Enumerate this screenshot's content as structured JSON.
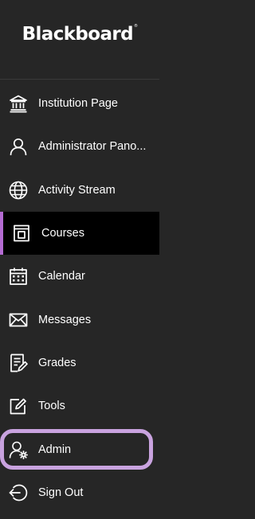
{
  "brand": {
    "logo_text": "Blackboard",
    "trademark": "®"
  },
  "colors": {
    "background": "#262626",
    "active_background": "#000000",
    "active_accent": "#b46bd2",
    "highlight_ring": "#c9a3df",
    "text": "#ffffff"
  },
  "nav": {
    "items": [
      {
        "label": "Institution Page",
        "icon": "institution-icon",
        "active": false,
        "highlighted": false
      },
      {
        "label": "Administrator Pano...",
        "icon": "user-icon",
        "active": false,
        "highlighted": false
      },
      {
        "label": "Activity Stream",
        "icon": "globe-icon",
        "active": false,
        "highlighted": false
      },
      {
        "label": "Courses",
        "icon": "courses-icon",
        "active": true,
        "highlighted": false
      },
      {
        "label": "Calendar",
        "icon": "calendar-icon",
        "active": false,
        "highlighted": false
      },
      {
        "label": "Messages",
        "icon": "envelope-icon",
        "active": false,
        "highlighted": false
      },
      {
        "label": "Grades",
        "icon": "grades-icon",
        "active": false,
        "highlighted": false
      },
      {
        "label": "Tools",
        "icon": "tools-icon",
        "active": false,
        "highlighted": false
      },
      {
        "label": "Admin",
        "icon": "admin-user-gear-icon",
        "active": false,
        "highlighted": true
      },
      {
        "label": "Sign Out",
        "icon": "sign-out-icon",
        "active": false,
        "highlighted": false
      }
    ]
  }
}
